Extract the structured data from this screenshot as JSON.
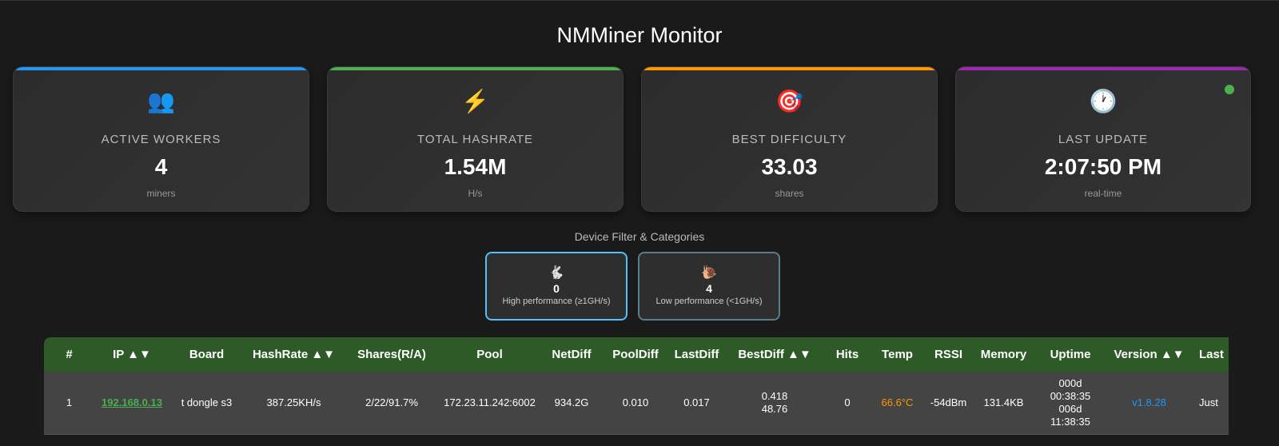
{
  "title": "NMMiner Monitor",
  "colors": {
    "workers": "#2196f3",
    "hashrate": "#4caf50",
    "difficulty": "#ff9800",
    "update": "#9c27b0",
    "status_dot": "#4caf50",
    "table_header": "#2e5a27"
  },
  "cards": [
    {
      "icon": "busts-in-silhouette-icon",
      "glyph": "👥",
      "label": "ACTIVE WORKERS",
      "value": "4",
      "unit": "miners"
    },
    {
      "icon": "lightning-icon",
      "glyph": "⚡",
      "label": "TOTAL HASHRATE",
      "value": "1.54M",
      "unit": "H/s"
    },
    {
      "icon": "target-icon",
      "glyph": "🎯",
      "label": "BEST DIFFICULTY",
      "value": "33.03",
      "unit": "shares"
    },
    {
      "icon": "clock-icon",
      "glyph": "🕐",
      "label": "LAST UPDATE",
      "value": "2:07:50 PM",
      "unit": "real-time"
    }
  ],
  "filter": {
    "title": "Device Filter & Categories",
    "buttons": [
      {
        "icon": "rabbit-icon",
        "glyph": "🐇",
        "count": "0",
        "label": "High performance (≥1GH/s)"
      },
      {
        "icon": "snail-icon",
        "glyph": "🐌",
        "count": "4",
        "label": "Low performance (<1GH/s)"
      }
    ]
  },
  "table": {
    "headers": [
      "#",
      "IP ▲▼",
      "Board",
      "HashRate ▲▼",
      "Shares(R/A)",
      "Pool",
      "NetDiff",
      "PoolDiff",
      "LastDiff",
      "BestDiff ▲▼",
      "Hits",
      "Temp",
      "RSSI",
      "Memory",
      "Uptime",
      "Version ▲▼",
      "Last"
    ],
    "rows": [
      {
        "num": "1",
        "ip": "192.168.0.13",
        "board": "t dongle s3",
        "hashrate": "387.25KH/s",
        "shares": "2/22/91.7%",
        "pool": "172.23.11.242:6002",
        "netdiff": "934.2G",
        "pooldiff": "0.010",
        "lastdiff": "0.017",
        "bestdiff": [
          "0.418",
          "48.76"
        ],
        "hits": "0",
        "temp": "66.6°C",
        "rssi": "-54dBm",
        "memory": "131.4KB",
        "uptime": [
          "000d",
          "00:38:35",
          "006d",
          "11:38:35"
        ],
        "version": "v1.8.28",
        "last": "Just"
      }
    ]
  }
}
